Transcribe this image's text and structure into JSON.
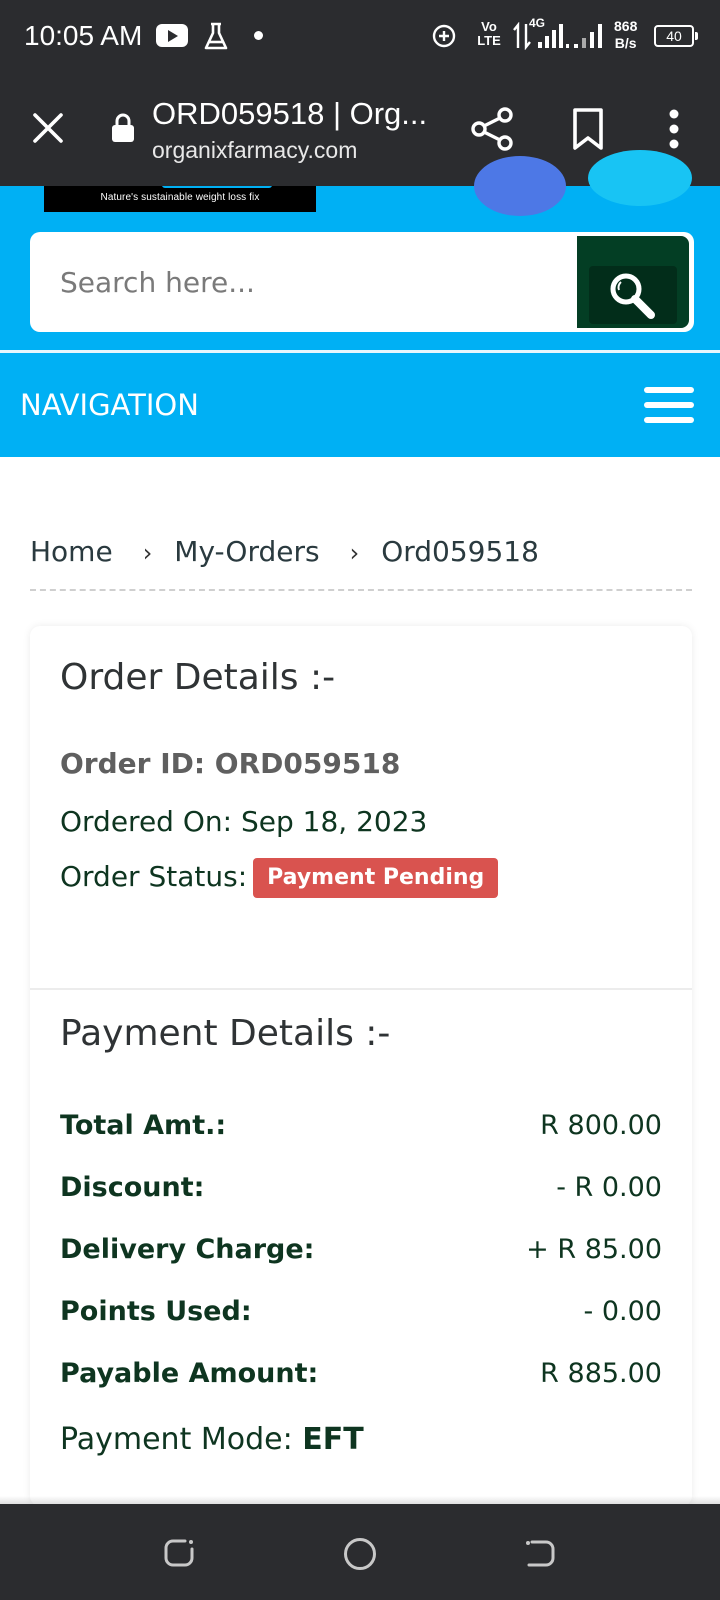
{
  "status_bar": {
    "time": "10:05 AM",
    "volte_line1": "Vo",
    "volte_line2": "LTE",
    "network": "4G",
    "speed_value": "868",
    "speed_unit": "B/s",
    "battery": "40",
    "icons": [
      "youtube-icon",
      "flask-icon",
      "notification-dot-icon",
      "add-circle-icon",
      "data-arrows-icon",
      "signal-4g-icon",
      "signal-icon",
      "battery-icon"
    ]
  },
  "browser": {
    "page_title": "ORD059518 | Org...",
    "url": "organixfarmacy.com",
    "icons": [
      "close-icon",
      "lock-icon",
      "share-icon",
      "bookmark-icon",
      "more-vert-icon"
    ]
  },
  "header": {
    "logo_tagline": "Nature's sustainable weight loss fix",
    "search_placeholder": "Search here...",
    "nav_label": "NAVIGATION",
    "colors": {
      "header_bg": "#00b0f4",
      "search_button": "#033e24"
    }
  },
  "breadcrumb": {
    "items": [
      "Home",
      "My-Orders",
      "Ord059518"
    ],
    "separator": "›"
  },
  "order_details": {
    "title": "Order Details :-",
    "order_id_line": "Order ID: ORD059518",
    "ordered_on_line": "Ordered On: Sep 18, 2023",
    "status_label": "Order Status:",
    "status_badge": "Payment Pending",
    "badge_color": "#d9534f"
  },
  "payment_details": {
    "title": "Payment Details :-",
    "rows": [
      {
        "label": "Total Amt.:",
        "value": "R 800.00"
      },
      {
        "label": "Discount:",
        "value": "- R 0.00"
      },
      {
        "label": "Delivery Charge:",
        "value": "+ R 85.00"
      },
      {
        "label": "Points Used:",
        "value": "- 0.00"
      },
      {
        "label": "Payable Amount:",
        "value": "R 885.00"
      }
    ],
    "mode_label": "Payment Mode:",
    "mode_value": "EFT"
  },
  "system_nav": {
    "icons": [
      "recent-apps-icon",
      "home-icon",
      "back-icon"
    ]
  }
}
